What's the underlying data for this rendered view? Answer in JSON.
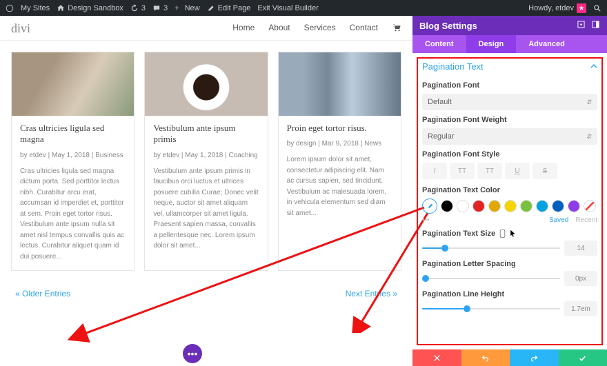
{
  "adminbar": {
    "my_sites": "My Sites",
    "site_name": "Design Sandbox",
    "updates": "3",
    "comments": "3",
    "new": "New",
    "edit_page": "Edit Page",
    "exit_vb": "Exit Visual Builder",
    "howdy": "Howdy, etdev"
  },
  "site": {
    "logo": "divi",
    "nav": {
      "home": "Home",
      "about": "About",
      "services": "Services",
      "contact": "Contact"
    },
    "posts": [
      {
        "title": "Cras ultricies ligula sed magna",
        "meta": "by etdev | May 1, 2018 | Business",
        "excerpt": "Cras ultricies ligula sed magna dictum porta. Sed porttitor lectus nibh. Curabitur arcu erat, accumsan id imperdiet et, porttitor at sem. Proin eget tortor risus. Vestibulum ante ipsum nulla sit amet nisl tempus convallis quis ac lectus. Curabitur aliquet quam id dui posuere..."
      },
      {
        "title": "Vestibulum ante ipsum primis",
        "meta": "by etdev | May 1, 2018 | Coaching",
        "excerpt": "Vestibulum ante ipsum primis in faucibus orci luctus et ultrices posuere cubilia Curae; Donec velit neque, auctor sit amet aliquam vel, ullamcorper sit amet ligula. Praesent sapien massa, convallis a pellentesque nec. Lorem ipsum dolor sit amet..."
      },
      {
        "title": "Proin eget tortor risus.",
        "meta": "by design | Mar 9, 2018 | News",
        "excerpt": "Lorem ipsum dolor sit amet, consectetur adipiscing elit. Nam ac cursus sapien, sed tincidunt. Vestibulum ac malesuada lorem, in vehicula elementum sed diam sit amet..."
      }
    ],
    "pagination": {
      "older": "« Older Entries",
      "next": "Next Entries »"
    }
  },
  "panel": {
    "title": "Blog Settings",
    "tabs": {
      "content": "Content",
      "design": "Design",
      "advanced": "Advanced"
    },
    "section": "Pagination Text",
    "font_label": "Pagination Font",
    "font_value": "Default",
    "weight_label": "Pagination Font Weight",
    "weight_value": "Regular",
    "style_label": "Pagination Font Style",
    "styles": {
      "italic": "I",
      "upper": "TT",
      "small": "TT",
      "underline": "U",
      "strike": "S"
    },
    "color_label": "Pagination Text Color",
    "color_dots": "•••",
    "saved": "Saved",
    "recent": "Recent",
    "size_label": "Pagination Text Size",
    "size_value": "14",
    "spacing_label": "Pagination Letter Spacing",
    "spacing_value": "0px",
    "lineheight_label": "Pagination Line Height",
    "lineheight_value": "1.7em",
    "swatches": [
      "#000000",
      "#ffffff",
      "#e02424",
      "#e0a800",
      "#f5d400",
      "#7ac142",
      "#00a2e0",
      "#0060c0",
      "#8e3de8"
    ]
  },
  "botbar": {
    "colors": [
      "#ff5252",
      "#ff9a3c",
      "#29b6f6",
      "#26c685"
    ]
  }
}
